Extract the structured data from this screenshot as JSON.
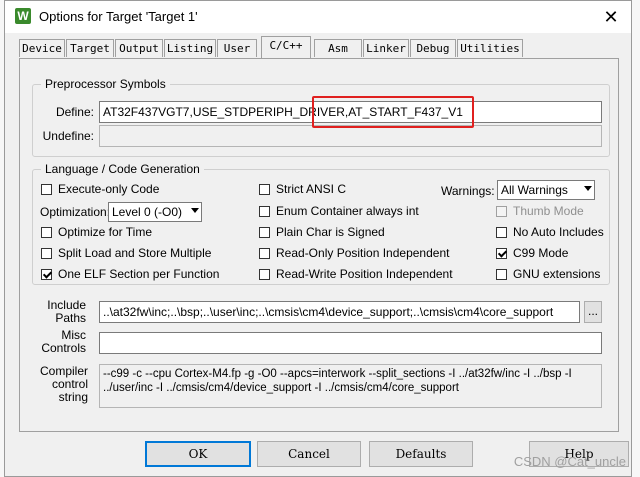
{
  "window": {
    "app_icon_letter": "W",
    "title": "Options for Target 'Target 1'",
    "close_glyph": "✕"
  },
  "tabs": [
    "Device",
    "Target",
    "Output",
    "Listing",
    "User",
    "C/C++",
    "Asm",
    "Linker",
    "Debug",
    "Utilities"
  ],
  "active_tab": "C/C++",
  "preprocessor": {
    "legend": "Preprocessor Symbols",
    "define_label": "Define:",
    "define_value": "AT32F437VGT7,USE_STDPERIPH_DRIVER,AT_START_F437_V1",
    "undefine_label": "Undefine:",
    "undefine_value": ""
  },
  "language": {
    "legend": "Language / Code Generation",
    "execute_only": "Execute-only Code",
    "optimization_label": "Optimization:",
    "optimization_value": "Level 0 (-O0)",
    "optimize_time": "Optimize for Time",
    "split_load": "Split Load and Store Multiple",
    "one_elf": "One ELF Section per Function",
    "strict_ansi": "Strict ANSI C",
    "enum_container": "Enum Container always int",
    "plain_char": "Plain Char is Signed",
    "ropi": "Read-Only Position Independent",
    "rwpi": "Read-Write Position Independent",
    "warnings_label": "Warnings:",
    "warnings_value": "All Warnings",
    "thumb_mode": "Thumb Mode",
    "no_auto_includes": "No Auto Includes",
    "c99_mode": "C99 Mode",
    "gnu_extensions": "GNU extensions",
    "checked": {
      "execute_only": false,
      "optimize_time": false,
      "split_load": false,
      "one_elf": true,
      "strict_ansi": false,
      "enum_container": false,
      "plain_char": false,
      "ropi": false,
      "rwpi": false,
      "thumb_mode": false,
      "no_auto_includes": false,
      "c99_mode": true,
      "gnu_extensions": false
    }
  },
  "include_paths": {
    "label_line1": "Include",
    "label_line2": "Paths",
    "value": "..\\at32fw\\inc;..\\bsp;..\\user\\inc;..\\cmsis\\cm4\\device_support;..\\cmsis\\cm4\\core_support",
    "browse": "..."
  },
  "misc_controls": {
    "label_line1": "Misc",
    "label_line2": "Controls",
    "value": ""
  },
  "compiler_string": {
    "label_line1": "Compiler",
    "label_line2": "control",
    "label_line3": "string",
    "line1": "--c99 -c --cpu Cortex-M4.fp -g -O0 --apcs=interwork --split_sections -I ../at32fw/inc -I ../bsp -I",
    "line2": "../user/inc -I ../cmsis/cm4/device_support -I ../cmsis/cm4/core_support"
  },
  "buttons": {
    "ok": "OK",
    "cancel": "Cancel",
    "defaults": "Defaults",
    "help": "Help"
  },
  "watermark": "CSDN @Cat_uncle"
}
